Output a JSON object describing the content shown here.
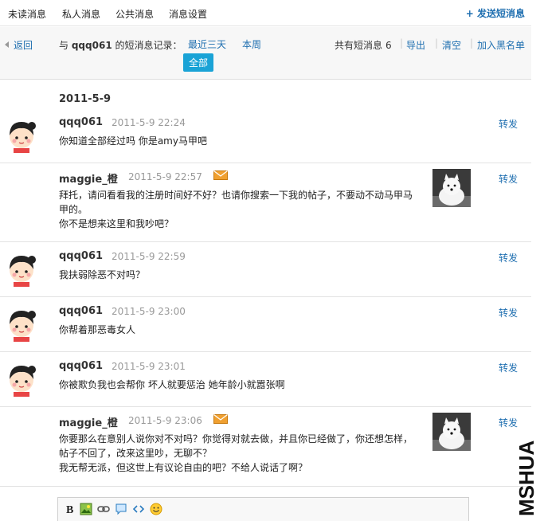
{
  "tabs": [
    {
      "label": "未读消息"
    },
    {
      "label": "私人消息"
    },
    {
      "label": "公共消息"
    },
    {
      "label": "消息设置"
    }
  ],
  "send_link": "+ 发送短消息",
  "toolbar": {
    "back": "返回",
    "prefix": "与",
    "partner": "qqq061",
    "suffix": "的短消息记录：",
    "filters": [
      "最近三天",
      "本周"
    ],
    "filter_all": "全部",
    "count_label": "共有短消息",
    "count_value": "6",
    "export": "导出",
    "clear": "清空",
    "blacklist": "加入黑名单"
  },
  "date_heading": "2011-5-9",
  "messages": [
    {
      "author": "qqq061",
      "time": "2011-5-9 22:24",
      "lines": [
        "你知道全部经过吗    你是amy马甲吧"
      ],
      "forward": "转发"
    },
    {
      "author": "maggie_橙",
      "time": "2011-5-9 22:57",
      "lines": [
        "拜托，请问看看我的注册时间好不好？也请你搜索一下我的帖子，不要动不动马甲马",
        "甲的。",
        "你不是想来这里和我吵吧？"
      ],
      "forward": "转发"
    },
    {
      "author": "qqq061",
      "time": "2011-5-9 22:59",
      "lines": [
        "我扶弱除恶不对吗？"
      ],
      "forward": "转发"
    },
    {
      "author": "qqq061",
      "time": "2011-5-9 23:00",
      "lines": [
        "你帮着那恶毒女人"
      ],
      "forward": "转发"
    },
    {
      "author": "qqq061",
      "time": "2011-5-9 23:01",
      "lines": [
        "你被欺负我也会帮你    坏人就要惩治    她年龄小就嚣张啊"
      ],
      "forward": "转发"
    },
    {
      "author": "maggie_橙",
      "time": "2011-5-9 23:06",
      "lines": [
        "你要那么在意别人说你对不对吗？你觉得对就去做，并且你已经做了，你还想怎样，",
        "帖子不回了，改来这里吵，无聊不？",
        "我无帮无派，但这世上有议论自由的吧？不给人说话了啊？"
      ],
      "forward": "转发"
    }
  ],
  "watermark": "MSHUA",
  "colors": {
    "link": "#1f6fb0",
    "accent": "#1aa3d6",
    "divider": "#e3e3e3"
  },
  "editor_icons": [
    "bold-icon",
    "image-icon",
    "link-icon",
    "quote-icon",
    "code-icon",
    "smiley-icon"
  ]
}
